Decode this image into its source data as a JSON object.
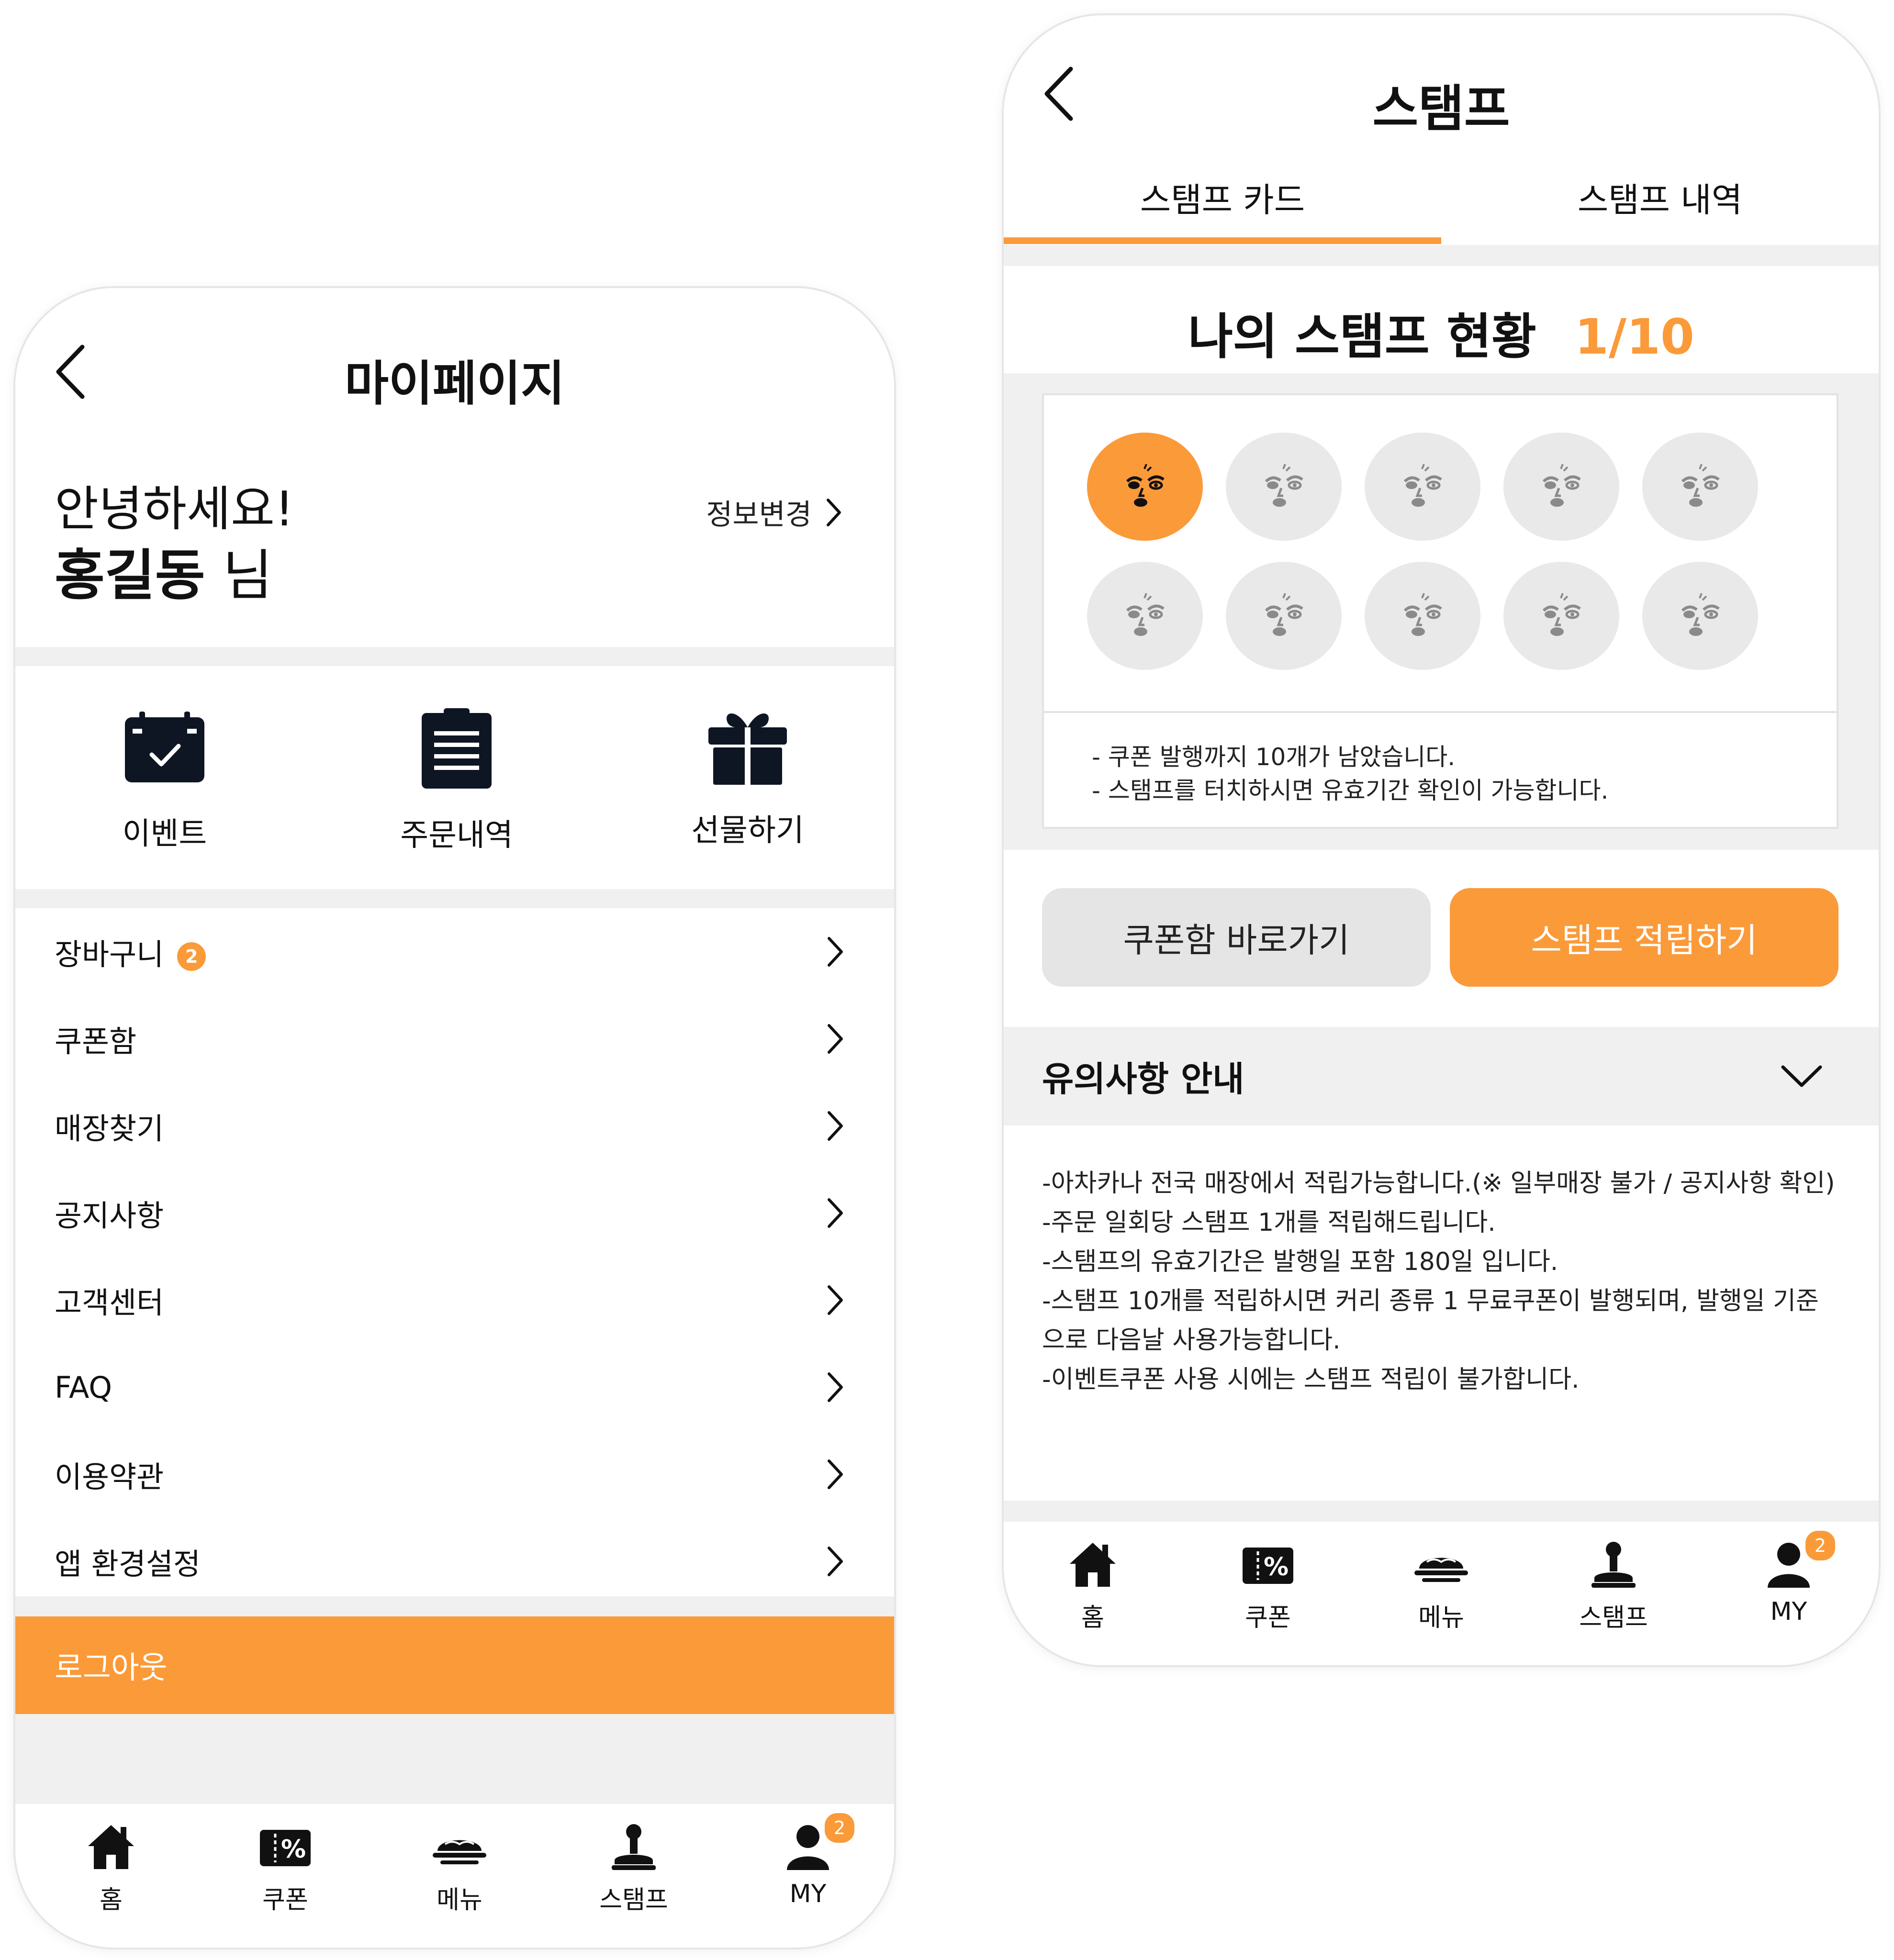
{
  "colors": {
    "accent": "#fb9a39",
    "stamp_off": "#e9e9e9",
    "button_gray": "#e5e5e5",
    "section_gap": "#f0f0f0"
  },
  "mypage": {
    "title": "마이페이지",
    "greeting": "안녕하세요!",
    "user_name": "홍길동",
    "honorific": "님",
    "edit_info": "정보변경",
    "quick_menu": [
      {
        "label": "이벤트",
        "icon": "calendar-check-icon"
      },
      {
        "label": "주문내역",
        "icon": "clipboard-list-icon"
      },
      {
        "label": "선물하기",
        "icon": "gift-icon"
      }
    ],
    "cart_badge": "2",
    "menu_items": [
      "장바구니",
      "쿠폰함",
      "매장찾기",
      "공지사항",
      "고객센터",
      "FAQ",
      "이용약관",
      "앱 환경설정"
    ],
    "logout": "로그아웃"
  },
  "stamp_page": {
    "title": "스탬프",
    "tabs": [
      "스탬프 카드",
      "스탬프 내역"
    ],
    "active_tab": "스탬프 카드",
    "status_label": "나의 스탬프 현황",
    "status_count": "1/10",
    "stamps_collected": 1,
    "stamps_total": 10,
    "card_notes": [
      "- 쿠폰 발행까지 10개가 남았습니다.",
      "- 스탬프를 터치하시면 유효기간 확인이 가능합니다."
    ],
    "btn_coupon_box": "쿠폰함 바로가기",
    "btn_collect": "스탬프 적립하기",
    "notice_title": "유의사항 안내",
    "notice_lines": [
      "-아차카나 전국 매장에서 적립가능합니다.(※ 일부매장 불가 / 공지사항 확인)",
      "-주문 일회당 스탬프 1개를 적립해드립니다.",
      "-스탬프의 유효기간은 발행일 포함 180일 입니다.",
      "-스탬프 10개를 적립하시면 커리 종류 1 무료쿠폰이 발행되며, 발행일 기준으로 다음날 사용가능합니다.",
      "-이벤트쿠폰 사용 시에는 스탬프 적립이 불가합니다."
    ]
  },
  "tabbar": {
    "items": [
      {
        "label": "홈",
        "icon": "home-icon"
      },
      {
        "label": "쿠폰",
        "icon": "coupon-icon"
      },
      {
        "label": "메뉴",
        "icon": "menu-dish-icon"
      },
      {
        "label": "스탬프",
        "icon": "stamp-icon"
      },
      {
        "label": "MY",
        "icon": "user-icon"
      }
    ],
    "my_badge": "2"
  }
}
